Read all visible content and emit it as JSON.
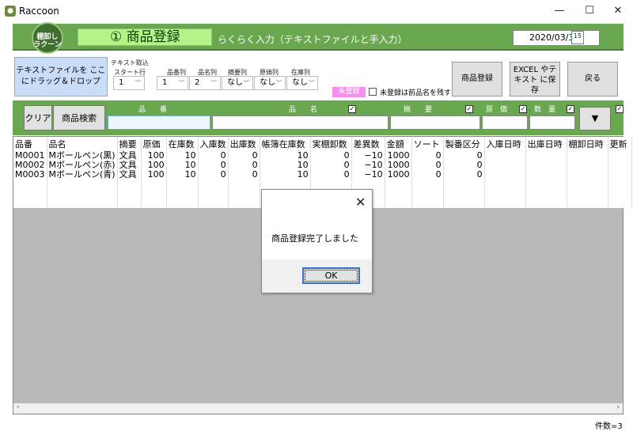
{
  "window": {
    "title": "Raccoon",
    "icon": "raccoon-app-icon",
    "min": "—",
    "max": "☐",
    "close": "✕"
  },
  "header": {
    "logo_text": "棚卸し ラクーン",
    "screen_title": "① 商品登録",
    "subtitle": "らくらく入力（テキストファイルと手入力）",
    "date": "2020/03/31",
    "calendar_day": "15"
  },
  "import": {
    "drop_zone": "テキストファイルを ここにドラッグ＆ドロップ",
    "section_label": "テキスト取込",
    "start_row_label": "スタート行",
    "start_row_value": "1",
    "columns": [
      {
        "label": "品番列",
        "value": "1"
      },
      {
        "label": "品名列",
        "value": "2"
      },
      {
        "label": "摘要列",
        "value": "なし"
      },
      {
        "label": "原価列",
        "value": "なし"
      },
      {
        "label": "在庫列",
        "value": "なし"
      }
    ],
    "unregistered_badge": "未登録",
    "keep_name_label": "未登録は前品名を残す"
  },
  "actions": {
    "register": "商品登録",
    "export": "EXCEL やテキスト に保存",
    "back": "戻る"
  },
  "search": {
    "clear": "クリア",
    "search": "商品検索",
    "dropdown": "▼",
    "captions": {
      "code": "品　　番",
      "name": "品　　名",
      "summary": "摘　　要",
      "cost": "原　価",
      "qty": "数　量"
    },
    "checkmark": "✓"
  },
  "table": {
    "headers": [
      "品番",
      "品名",
      "摘要",
      "原価",
      "在庫数",
      "入庫数",
      "出庫数",
      "帳簿在庫数",
      "実棚卸数",
      "差異数",
      "金額",
      "ソート",
      "製番区分",
      "入庫日時",
      "出庫日時",
      "棚卸日時",
      "更新"
    ],
    "rows": [
      [
        "M0001",
        "Mボールペン(黒)",
        "文具",
        "100",
        "10",
        "0",
        "0",
        "10",
        "0",
        "−10",
        "1000",
        "0",
        "0",
        "",
        "",
        "",
        ""
      ],
      [
        "M0002",
        "Mボールペン(赤)",
        "文具",
        "100",
        "10",
        "0",
        "0",
        "10",
        "0",
        "−10",
        "1000",
        "0",
        "0",
        "",
        "",
        "",
        ""
      ],
      [
        "M0003",
        "Mボールペン(青)",
        "文具",
        "100",
        "10",
        "0",
        "0",
        "10",
        "0",
        "−10",
        "1000",
        "0",
        "0",
        "",
        "",
        "",
        ""
      ]
    ]
  },
  "status": {
    "count": "件数=3"
  },
  "dialog": {
    "message": "商品登録完了しました",
    "ok": "OK",
    "close": "✕"
  }
}
